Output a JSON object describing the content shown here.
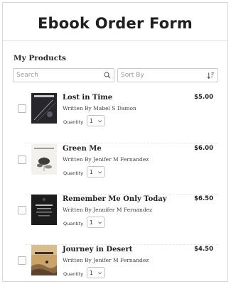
{
  "page": {
    "title": "Ebook Order Form"
  },
  "section": {
    "label": "My Products"
  },
  "search": {
    "placeholder": "Search",
    "icon": "search-icon"
  },
  "sort": {
    "label": "Sort By",
    "icon": "sort-order-icon"
  },
  "quantity_label": "Quantity",
  "products": [
    {
      "title": "Lost in Time",
      "author": "Written By Mabel S Damon",
      "price": "$5.00",
      "quantity": "1",
      "checked": false,
      "cover_text": "LOST IN TIME",
      "cover_colors": [
        "#1b1b1f",
        "#3a3a44"
      ]
    },
    {
      "title": "Green Me",
      "author": "Written By Jenifer M Fernandez",
      "price": "$6.00",
      "quantity": "1",
      "checked": false,
      "cover_text": "GREEN ME",
      "cover_colors": [
        "#f2f0ec",
        "#5b5b55"
      ]
    },
    {
      "title": "Remember Me Only Today",
      "author": "Written By Jennifer M Fernandez",
      "price": "$6.50",
      "quantity": "1",
      "checked": false,
      "cover_text": "REMEMBER ME ONLY TODAY",
      "cover_colors": [
        "#1c1c1c",
        "#6b6b6b"
      ]
    },
    {
      "title": "Journey in Desert",
      "author": "Written By Jenifer M Fernandez",
      "price": "$4.50",
      "quantity": "1",
      "checked": false,
      "cover_text": "TRAVEL",
      "cover_colors": [
        "#caa46a",
        "#4a3b2a"
      ]
    }
  ]
}
